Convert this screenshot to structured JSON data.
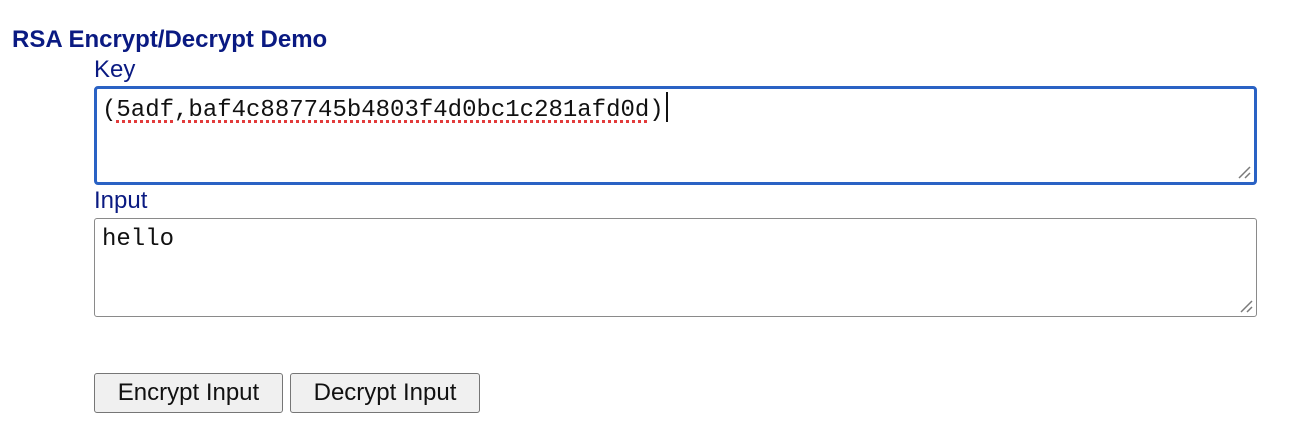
{
  "page": {
    "title": "RSA Encrypt/Decrypt Demo"
  },
  "key_field": {
    "label": "Key",
    "value": "(5adf,baf4c887745b4803f4d0bc1c281afd0d)",
    "value_parts": {
      "open": "(",
      "misspelled": "5adf,baf4c887745b4803f4d0bc1c281afd0d",
      "close": ")"
    },
    "focused": true
  },
  "input_field": {
    "label": "Input",
    "value": "hello"
  },
  "buttons": {
    "encrypt_label": "Encrypt Input",
    "decrypt_label": "Decrypt Input"
  },
  "colors": {
    "title": "#0a1a82",
    "focus_ring": "#2a62c4",
    "spellcheck": "#e23b3b"
  },
  "icons": {
    "resize": "resize-grip-icon"
  }
}
